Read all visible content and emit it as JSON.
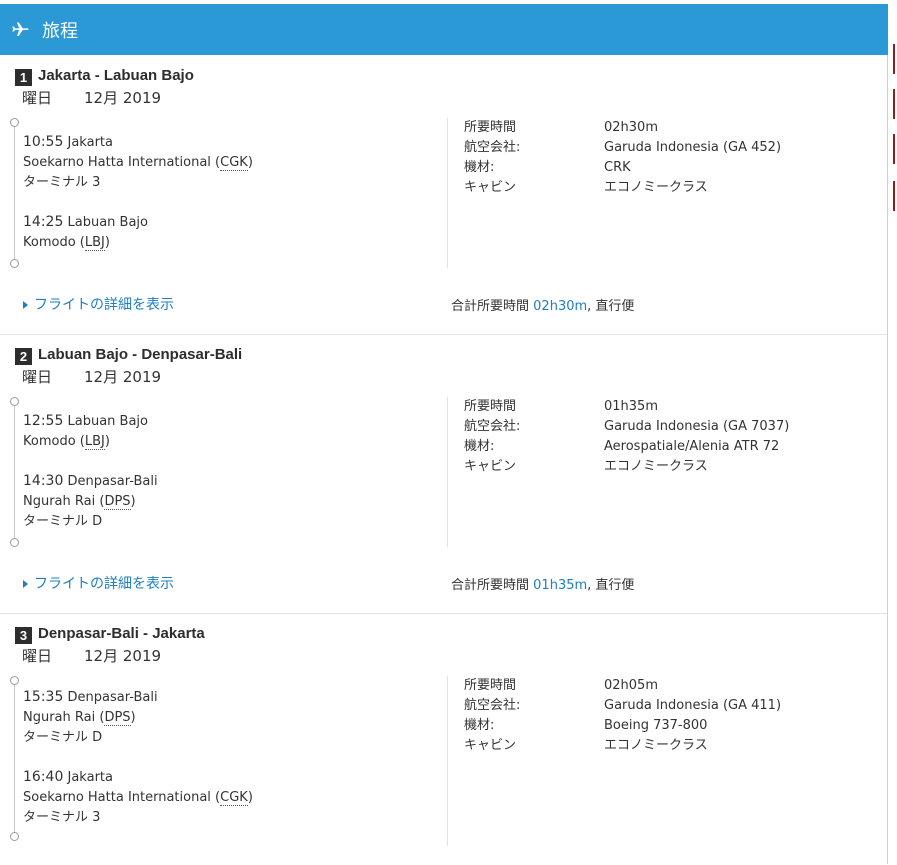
{
  "header": {
    "title": "旅程",
    "icon": "airplane-icon"
  },
  "segments": [
    {
      "num": "1",
      "route": "Jakarta - Labuan Bajo",
      "date_dow": "曜日",
      "date_month": "12月 2019",
      "departure": {
        "time": "10:55",
        "city": "Jakarta",
        "airport": "Soekarno Hatta International (",
        "code": "CGK",
        "airport_close": ")",
        "terminal": "ターミナル 3"
      },
      "arrival": {
        "time": "14:25",
        "city": "Labuan Bajo",
        "airport": "Komodo (",
        "code": "LBJ",
        "airport_close": ")",
        "terminal": ""
      },
      "info": [
        {
          "k": "所要時間",
          "v": "02h30m"
        },
        {
          "k": "航空会社:",
          "v": "Garuda Indonesia (GA 452)"
        },
        {
          "k": "機材:",
          "v": "CRK"
        },
        {
          "k": "キャビン",
          "v": "エコノミークラス"
        }
      ],
      "details_link": "フライトの詳細を表示",
      "total_label": "合計所要時間",
      "total_duration": "02h30m",
      "total_suffix": ", 直行便"
    },
    {
      "num": "2",
      "route": "Labuan Bajo - Denpasar-Bali",
      "date_dow": "曜日",
      "date_month": "12月 2019",
      "departure": {
        "time": "12:55",
        "city": "Labuan Bajo",
        "airport": "Komodo (",
        "code": "LBJ",
        "airport_close": ")",
        "terminal": ""
      },
      "arrival": {
        "time": "14:30",
        "city": "Denpasar-Bali",
        "airport": "Ngurah Rai (",
        "code": "DPS",
        "airport_close": ")",
        "terminal": "ターミナル D"
      },
      "info": [
        {
          "k": "所要時間",
          "v": "01h35m"
        },
        {
          "k": "航空会社:",
          "v": "Garuda Indonesia (GA 7037)"
        },
        {
          "k": "機材:",
          "v": "Aerospatiale/Alenia ATR 72"
        },
        {
          "k": "キャビン",
          "v": "エコノミークラス"
        }
      ],
      "details_link": "フライトの詳細を表示",
      "total_label": "合計所要時間",
      "total_duration": "01h35m",
      "total_suffix": ", 直行便"
    },
    {
      "num": "3",
      "route": "Denpasar-Bali - Jakarta",
      "date_dow": "曜日",
      "date_month": "12月 2019",
      "departure": {
        "time": "15:35",
        "city": "Denpasar-Bali",
        "airport": "Ngurah Rai (",
        "code": "DPS",
        "airport_close": ")",
        "terminal": "ターミナル D"
      },
      "arrival": {
        "time": "16:40",
        "city": "Jakarta",
        "airport": "Soekarno Hatta International (",
        "code": "CGK",
        "airport_close": ")",
        "terminal": "ターミナル 3"
      },
      "info": [
        {
          "k": "所要時間",
          "v": "02h05m"
        },
        {
          "k": "航空会社:",
          "v": "Garuda Indonesia (GA 411)"
        },
        {
          "k": "機材:",
          "v": "Boeing 737-800"
        },
        {
          "k": "キャビン",
          "v": "エコノミークラス"
        }
      ]
    }
  ]
}
